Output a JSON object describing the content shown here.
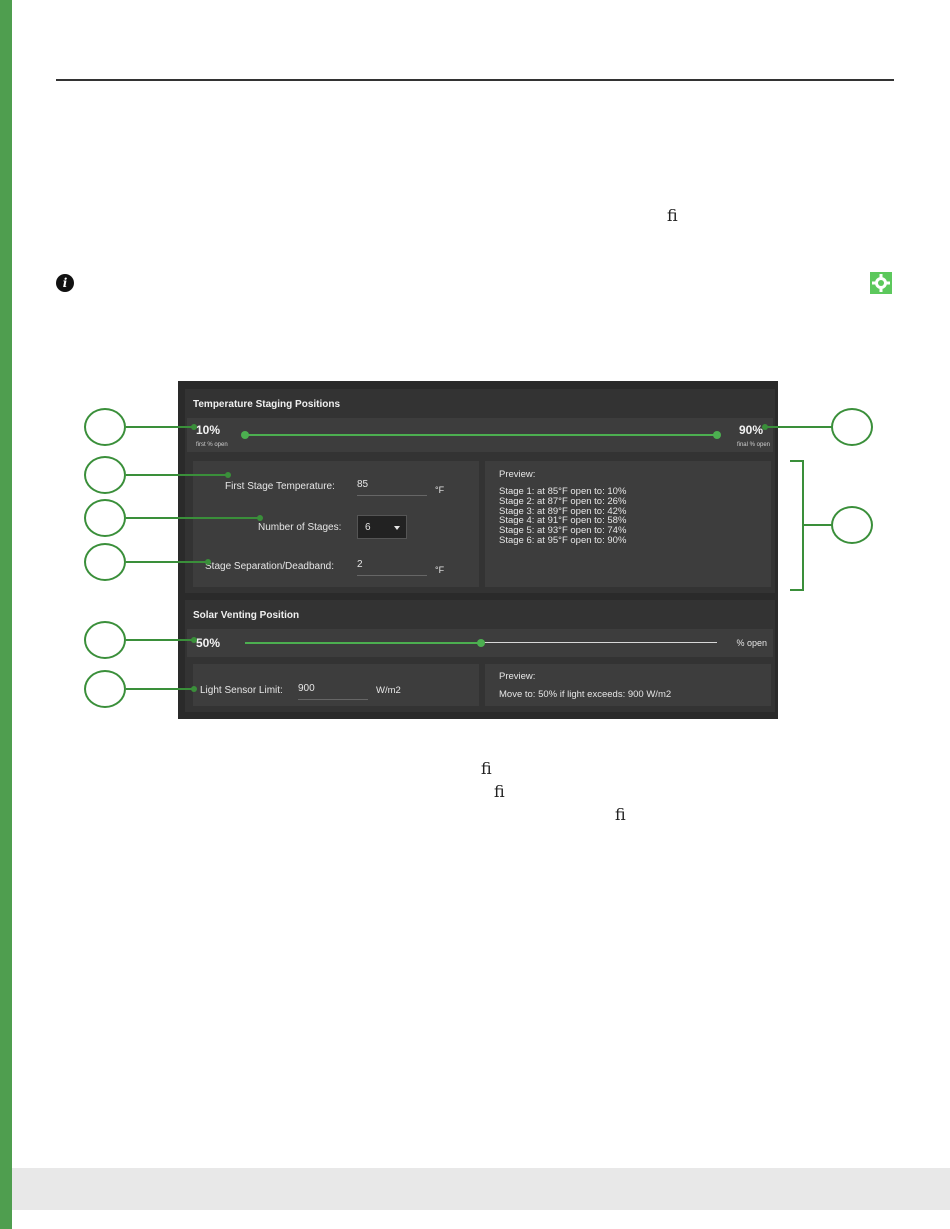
{
  "page": {
    "ligature_glyph": "ﬁ"
  },
  "icons": {
    "info": "info-icon",
    "settings": "gear-icon",
    "settings_color": "#5cc85c",
    "accent": "#4f9e4f"
  },
  "screenshot": {
    "temperature": {
      "title": "Temperature Staging Positions",
      "first_value": "10%",
      "first_label": "first % open",
      "final_value": "90%",
      "final_label": "final % open",
      "range_start_pct": 10,
      "range_end_pct": 90,
      "first_stage_temp_label": "First Stage Temperature:",
      "first_stage_temp_value": "85",
      "first_stage_temp_unit": "°F",
      "num_stages_label": "Number of Stages:",
      "num_stages_value": "6",
      "separation_label": "Stage Separation/Deadband:",
      "separation_value": "2",
      "separation_unit": "°F",
      "preview_title": "Preview:",
      "preview_lines": [
        "Stage 1:  at 85°F open to: 10%",
        "Stage 2:  at 87°F open to: 26%",
        "Stage 3:  at 89°F open to: 42%",
        "Stage 4:  at 91°F open to: 58%",
        "Stage 5:  at 93°F open to: 74%",
        "Stage 6:  at 95°F open to: 90%"
      ]
    },
    "solar": {
      "title": "Solar Venting Position",
      "value": "50%",
      "value_pct": 50,
      "unit_label": "% open",
      "light_label": "Light Sensor Limit:",
      "light_value": "900",
      "light_unit": "W/m2",
      "preview_title": "Preview:",
      "preview_text": "Move to: 50% if light exceeds: 900 W/m2"
    }
  }
}
